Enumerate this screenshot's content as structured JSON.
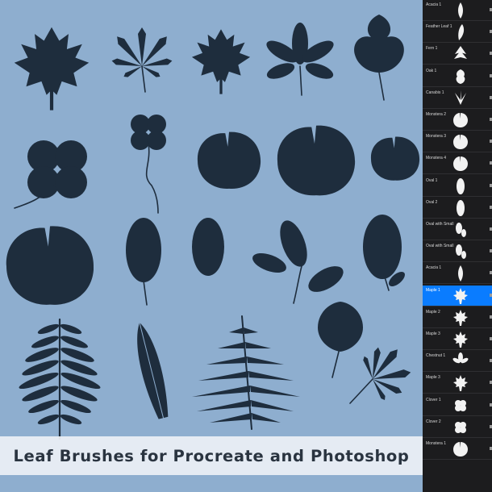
{
  "banner": {
    "title": "Leaf Brushes for Procreate and Photoshop"
  },
  "colors": {
    "canvas_bg": "#8eaecf",
    "leaf_fill": "#1e2d3d",
    "panel_bg": "#1c1c1e",
    "selected_row": "#0a7cff",
    "banner_bg": "#eef1f5"
  },
  "brush_library": {
    "items": [
      {
        "label": "Acacia 1",
        "selected": false,
        "preview_icon": "acacia-leaf-icon"
      },
      {
        "label": "Feather Leaf 1",
        "selected": false,
        "preview_icon": "feather-leaf-icon"
      },
      {
        "label": "Fern 1",
        "selected": false,
        "preview_icon": "fern-leaf-icon"
      },
      {
        "label": "Oak 1",
        "selected": false,
        "preview_icon": "oak-leaf-icon"
      },
      {
        "label": "Canabis 1",
        "selected": false,
        "preview_icon": "palmate-leaf-icon"
      },
      {
        "label": "Monstera 2",
        "selected": false,
        "preview_icon": "monstera-leaf-icon"
      },
      {
        "label": "Monstera 3",
        "selected": false,
        "preview_icon": "monstera-leaf-icon"
      },
      {
        "label": "Monstera 4",
        "selected": false,
        "preview_icon": "monstera-leaf-icon"
      },
      {
        "label": "Oval 1",
        "selected": false,
        "preview_icon": "oval-leaf-icon"
      },
      {
        "label": "Oval 2",
        "selected": false,
        "preview_icon": "oval-leaf-icon"
      },
      {
        "label": "Oval with Small L",
        "selected": false,
        "preview_icon": "oval-branch-icon"
      },
      {
        "label": "Oval with Small L",
        "selected": false,
        "preview_icon": "oval-branch-icon"
      },
      {
        "label": "Acacia 1",
        "selected": false,
        "preview_icon": "acacia-leaf-icon"
      },
      {
        "label": "Maple 1",
        "selected": true,
        "preview_icon": "maple-leaf-icon"
      },
      {
        "label": "Maple 2",
        "selected": false,
        "preview_icon": "maple-leaf-icon"
      },
      {
        "label": "Maple 3",
        "selected": false,
        "preview_icon": "maple-leaf-icon"
      },
      {
        "label": "Chestnut 1",
        "selected": false,
        "preview_icon": "chestnut-leaf-icon"
      },
      {
        "label": "Maple 3",
        "selected": false,
        "preview_icon": "maple-leaf-icon"
      },
      {
        "label": "Clover 1",
        "selected": false,
        "preview_icon": "clover-leaf-icon"
      },
      {
        "label": "Clover 2",
        "selected": false,
        "preview_icon": "clover-leaf-icon"
      },
      {
        "label": "Monstera 1",
        "selected": false,
        "preview_icon": "monstera-leaf-icon"
      }
    ]
  }
}
